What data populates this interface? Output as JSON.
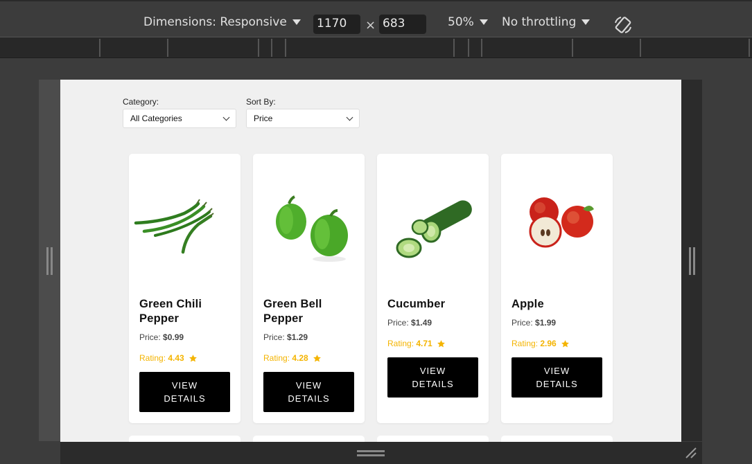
{
  "devtools": {
    "dimensions_label": "Dimensions: Responsive",
    "width_value": "1170",
    "times_symbol": "×",
    "height_value": "683",
    "zoom": "50%",
    "throttling": "No throttling",
    "rotate_icon": "rotate-icon"
  },
  "filters": {
    "category_label": "Category:",
    "category_value": "All Categories",
    "sort_label": "Sort By:",
    "sort_value": "Price"
  },
  "products": [
    {
      "name": "Green Chili Pepper",
      "price_label": "Price:",
      "price": "$0.99",
      "rating_label": "Rating:",
      "rating": "4.43",
      "button": "VIEW DETAILS",
      "image": "green-chili-image"
    },
    {
      "name": "Green Bell Pepper",
      "price_label": "Price:",
      "price": "$1.29",
      "rating_label": "Rating:",
      "rating": "4.28",
      "button": "VIEW DETAILS",
      "image": "green-bell-pepper-image"
    },
    {
      "name": "Cucumber",
      "price_label": "Price:",
      "price": "$1.49",
      "rating_label": "Rating:",
      "rating": "4.71",
      "button": "VIEW DETAILS",
      "image": "cucumber-image"
    },
    {
      "name": "Apple",
      "price_label": "Price:",
      "price": "$1.99",
      "rating_label": "Rating:",
      "rating": "2.96",
      "button": "VIEW DETAILS",
      "image": "apple-image"
    }
  ],
  "colors": {
    "rating": "#f4b400",
    "button_bg": "#000000",
    "page_bg": "#f0f0f0"
  }
}
